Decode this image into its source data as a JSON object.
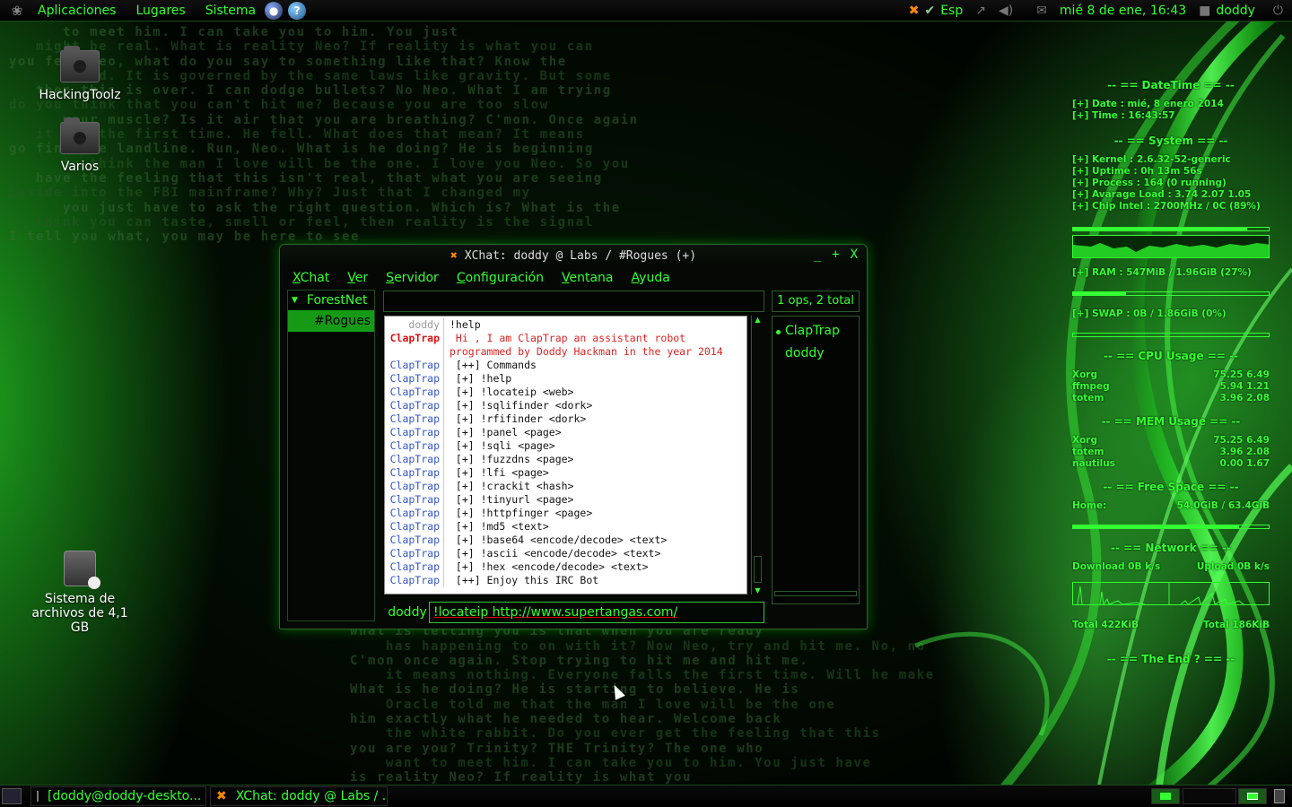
{
  "top_panel": {
    "menus": [
      "Aplicaciones",
      "Lugares",
      "Sistema"
    ],
    "keyboard_layout": "Esp",
    "clock": "mié  8 de ene, 16:43",
    "user": "doddy"
  },
  "desktop_icons": [
    {
      "label": "HackingToolz",
      "icon": "folder-icon"
    },
    {
      "label": "Varios",
      "icon": "folder-icon"
    },
    {
      "label": "Sistema de archivos de 4,1 GB",
      "icon": "drive-icon"
    }
  ],
  "matrix_lines": [
    "to meet him. I can take you to him. You just",
    "might be real. What is reality Neo? If reality is what you can",
    "you feel Neo, what do you say to something like that? Know the",
    "world. It is governed by the same laws like gravity. But some",
    "then this is over. I can dodge bullets? No Neo. What I am trying",
    "do you think that you can't hit me? Because you are too slow",
    "your muscle? Is it air that you are breathing? C'mon. Once again",
    "it for the first time. He fell. What does that mean? It means",
    "go find the landline. Run, Neo. What is he doing? He is beginning",
    "to think the man I love will be the one. I love you Neo. So you",
    "have the feeling that this isn't real, that what you are seeing",
    "inside into the FBI mainframe? Why? Just that I changed my",
    "you just have to ask the right question. Which is? What is the",
    "think you can taste, smell or feel, then reality is the signal",
    "I tell you what, you may be here to see"
  ],
  "matrix_lines_bottom": [
    "what is telling you is that when you are ready",
    "has happening to on with it? Now Neo, try and hit me. No, no",
    "C'mon once again. Stop trying to hit me and hit me.",
    "it means nothing. Everyone falls the first time. Will he make",
    "What is he doing? He is starting to believe. He is",
    "Oracle told me that the man I love will be the one",
    "him exactly what he needed to hear. Welcome back",
    "the white rabbit. Do you ever get the feeling that this",
    "you are you? Trinity? THE Trinity? The one who",
    "want to meet him. I can take you to him. You just have",
    "is reality Neo? If reality is what you"
  ],
  "conky": {
    "datetime_header": "-- == DateTime == --",
    "date": "[+] Date : mié,  8 enero 2014",
    "time": "[+] Time : 16:43:57",
    "system_header": "-- == System == --",
    "kernel": "[+] Kernel : 2.6.32-52-generic",
    "uptime": "[+] Uptime : 0h 13m 56s",
    "process": "[+] Process : 164 (0 running)",
    "load": "[+] Avarage Load : 3.74 2.07 1.05",
    "chip": "[+] Chip Intel : 2700MHz / 0C     (89%)",
    "cpu_bar_percent": 89,
    "ram": "[+] RAM : 547MiB / 1.96GiB (27%)",
    "ram_percent": 27,
    "swap": "[+] SWAP : 0B  / 1.86GiB (0%)",
    "swap_percent": 0,
    "cpu_usage_header": "-- == CPU Usage == --",
    "cpu_usage": [
      {
        "name": "Xorg",
        "values": "75.25 6.49"
      },
      {
        "name": "ffmpeg",
        "values": "5.94 1.21"
      },
      {
        "name": "totem",
        "values": "3.96 2.08"
      }
    ],
    "mem_usage_header": "-- == MEM Usage == --",
    "mem_usage": [
      {
        "name": "Xorg",
        "values": "75.25 6.49"
      },
      {
        "name": "totem",
        "values": "3.96 2.08"
      },
      {
        "name": "nautilus",
        "values": "0.00 1.67"
      }
    ],
    "free_space_header": "-- == Free Space == --",
    "home_label": "Home:",
    "home_value": "54.0GiB / 63.4GiB",
    "home_percent": 85,
    "network_header": "-- == Network == --",
    "download": "Download 0B   k/s",
    "upload": "Upload 0B   k/s",
    "total_down": "Total 422KiB",
    "total_up": "Total 186KiB",
    "end_header": "-- == The End ? == --"
  },
  "xchat": {
    "title": "XChat: doddy @ Labs / #Rogues (+)",
    "wm_buttons": [
      "_",
      "+",
      "X"
    ],
    "menus": [
      {
        "mn": "X",
        "rest": "Chat"
      },
      {
        "mn": "V",
        "rest": "er"
      },
      {
        "mn": "S",
        "rest": "ervidor"
      },
      {
        "mn": "C",
        "rest": "onfiguración"
      },
      {
        "mn": "V",
        "rest": "entana"
      },
      {
        "mn": "A",
        "rest": "yuda"
      }
    ],
    "network": "ForestNet",
    "channel": "#Rogues",
    "ops_label": "1 ops, 2 total",
    "messages": [
      {
        "nick": "doddy",
        "type": "self",
        "text": "!help"
      },
      {
        "nick": "ClapTrap",
        "type": "hl",
        "text": " Hi , I am ClapTrap an assistant robot"
      },
      {
        "nick": "",
        "type": "hl",
        "text": "programmed by Doddy Hackman in the year 2014"
      },
      {
        "nick": "ClapTrap",
        "type": "bot",
        "text": " [++] Commands"
      },
      {
        "nick": "ClapTrap",
        "type": "bot",
        "text": " [+] !help"
      },
      {
        "nick": "ClapTrap",
        "type": "bot",
        "text": " [+] !locateip <web>"
      },
      {
        "nick": "ClapTrap",
        "type": "bot",
        "text": " [+] !sqlifinder <dork>"
      },
      {
        "nick": "ClapTrap",
        "type": "bot",
        "text": " [+] !rfifinder <dork>"
      },
      {
        "nick": "ClapTrap",
        "type": "bot",
        "text": " [+] !panel <page>"
      },
      {
        "nick": "ClapTrap",
        "type": "bot",
        "text": " [+] !sqli <page>"
      },
      {
        "nick": "ClapTrap",
        "type": "bot",
        "text": " [+] !fuzzdns <page>"
      },
      {
        "nick": "ClapTrap",
        "type": "bot",
        "text": " [+] !lfi <page>"
      },
      {
        "nick": "ClapTrap",
        "type": "bot",
        "text": " [+] !crackit <hash>"
      },
      {
        "nick": "ClapTrap",
        "type": "bot",
        "text": " [+] !tinyurl <page>"
      },
      {
        "nick": "ClapTrap",
        "type": "bot",
        "text": " [+] !httpfinger <page>"
      },
      {
        "nick": "ClapTrap",
        "type": "bot",
        "text": " [+] !md5 <text>"
      },
      {
        "nick": "ClapTrap",
        "type": "bot",
        "text": " [+] !base64 <encode/decode> <text>"
      },
      {
        "nick": "ClapTrap",
        "type": "bot",
        "text": " [+] !ascii <encode/decode> <text>"
      },
      {
        "nick": "ClapTrap",
        "type": "bot",
        "text": " [+] !hex <encode/decode> <text>"
      },
      {
        "nick": "ClapTrap",
        "type": "bot",
        "text": " [++] Enjoy this IRC Bot"
      }
    ],
    "users": [
      {
        "name": "ClapTrap",
        "op": true
      },
      {
        "name": "doddy",
        "op": false
      }
    ],
    "nick": "doddy",
    "input_value": "!locateip http://www.supertangas.com/"
  },
  "bottom_panel": {
    "tasks": [
      "[doddy@doddy-deskto...",
      "XChat: doddy @ Labs / ..."
    ]
  },
  "colors": {
    "accent": "#33ff33",
    "bot_nick": "#3455c4",
    "highlight": "#dd1111"
  }
}
